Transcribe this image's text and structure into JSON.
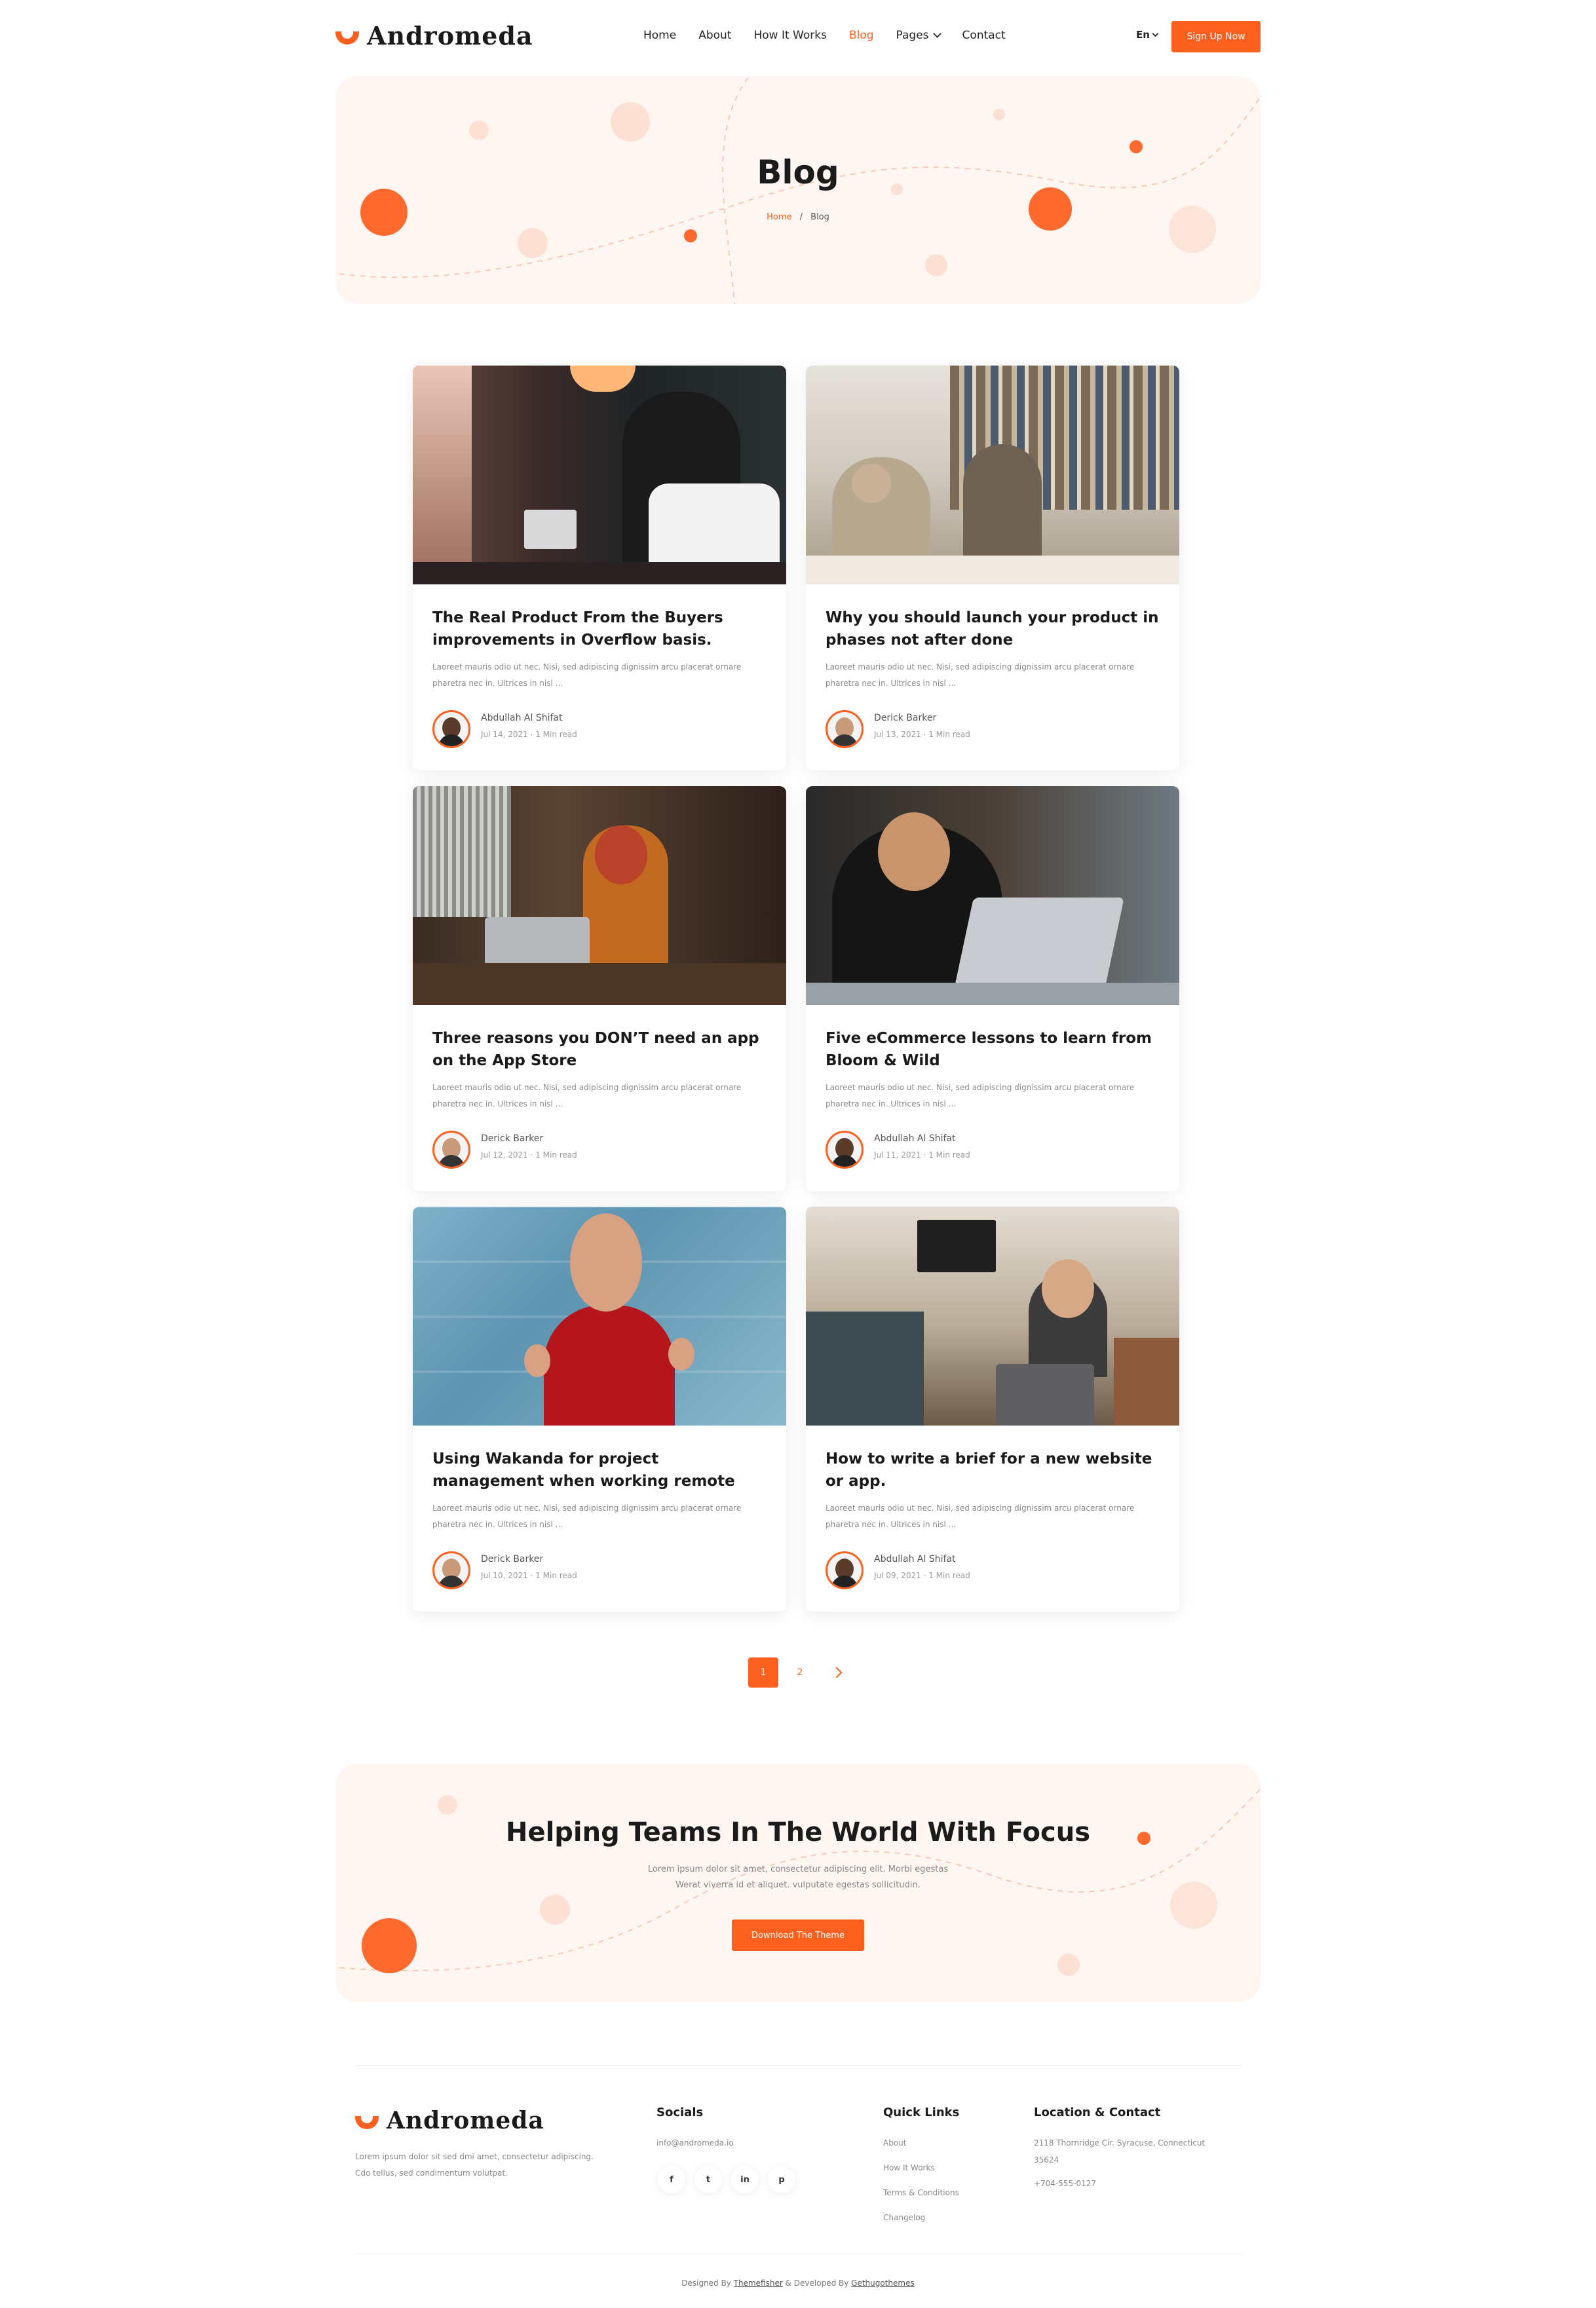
{
  "brand": {
    "name": "Andromeda",
    "accent": "#fd5f1f"
  },
  "nav": {
    "items": [
      "Home",
      "About",
      "How It Works",
      "Blog",
      "Pages",
      "Contact"
    ],
    "active": "Blog",
    "language": "En",
    "signup_label": "Sign Up Now"
  },
  "hero": {
    "title": "Blog",
    "breadcrumb": {
      "home": "Home",
      "separator": "/",
      "current": "Blog"
    }
  },
  "posts": [
    {
      "title": "The Real Product From the Buyers improvements in Overflow basis.",
      "excerpt": "Laoreet mauris odio ut nec. Nisi, sed adipiscing dignissim arcu placerat ornare pharetra nec in. Ultrices in nisl ...",
      "author": "Abdullah Al Shifat",
      "date": "Jul 14, 2021",
      "read": "1 Min read"
    },
    {
      "title": "Why you should launch your product in phases not after done",
      "excerpt": "Laoreet mauris odio ut nec. Nisi, sed adipiscing dignissim arcu placerat ornare pharetra nec in. Ultrices in nisl ...",
      "author": "Derick Barker",
      "date": "Jul 13, 2021",
      "read": "1 Min read"
    },
    {
      "title": "Three reasons you DON’T need an app on the App Store",
      "excerpt": "Laoreet mauris odio ut nec. Nisi, sed adipiscing dignissim arcu placerat ornare pharetra nec in. Ultrices in nisl ...",
      "author": "Derick Barker",
      "date": "Jul 12, 2021",
      "read": "1 Min read"
    },
    {
      "title": "Five eCommerce lessons to learn from Bloom & Wild",
      "excerpt": "Laoreet mauris odio ut nec. Nisi, sed adipiscing dignissim arcu placerat ornare pharetra nec in. Ultrices in nisl ...",
      "author": "Abdullah Al Shifat",
      "date": "Jul 11, 2021",
      "read": "1 Min read"
    },
    {
      "title": "Using Wakanda for project management when working remote",
      "excerpt": "Laoreet mauris odio ut nec. Nisi, sed adipiscing dignissim arcu placerat ornare pharetra nec in. Ultrices in nisl ...",
      "author": "Derick Barker",
      "date": "Jul 10, 2021",
      "read": "1 Min read"
    },
    {
      "title": "How to write a brief for a new website or app.",
      "excerpt": "Laoreet mauris odio ut nec. Nisi, sed adipiscing dignissim arcu placerat ornare pharetra nec in. Ultrices in nisl ...",
      "author": "Abdullah Al Shifat",
      "date": "Jul 09, 2021",
      "read": "1 Min read"
    }
  ],
  "pagination": {
    "pages": [
      "1",
      "2"
    ],
    "current": "1",
    "next_icon": "chevron-right-icon"
  },
  "cta": {
    "title": "Helping Teams In The World With Focus",
    "text": "Lorem ipsum dolor sit amet, consectetur adipiscing elit. Morbi egestas Werat viverra id et aliquet. vulputate egestas sollicitudin.",
    "button": "Download The Theme"
  },
  "footer": {
    "description": "Lorem ipsum dolor sit sed dmi amet, consectetur adipiscing. Cdo tellus, sed condimentum volutpat.",
    "socials_title": "Socials",
    "email": "info@andromeda.io",
    "social_icons": [
      "facebook-icon",
      "twitter-icon",
      "linkedin-icon",
      "pinterest-icon"
    ],
    "social_glyphs": [
      "f",
      "t",
      "in",
      "p"
    ],
    "quick_links_title": "Quick Links",
    "quick_links": [
      "About",
      "How It Works",
      "Terms & Conditions",
      "Changelog"
    ],
    "location_title": "Location & Contact",
    "address_line1": "2118 Thornridge Cir. Syracuse, Connecticut",
    "address_line2": "35624",
    "phone": "+704-555-0127",
    "copyright": {
      "prefix": "Designed By",
      "designer": "Themefisher",
      "middle": "& Developed By",
      "developer": "Gethugothemes"
    }
  }
}
